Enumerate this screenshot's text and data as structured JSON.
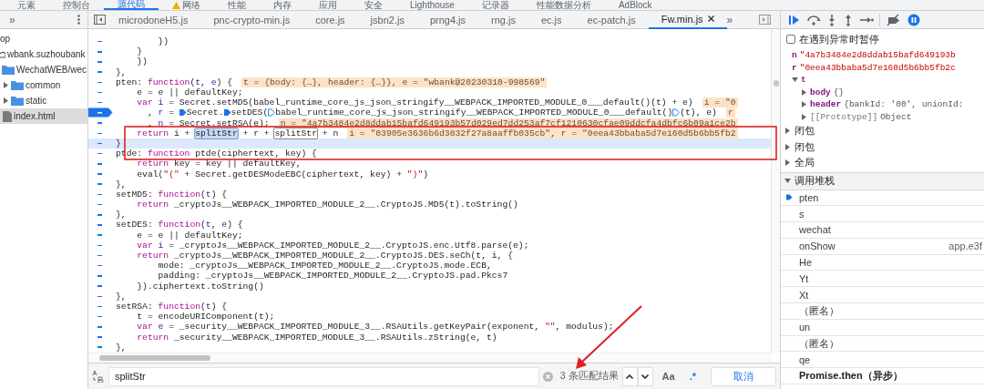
{
  "devtools_tabs": [
    {
      "label": "元素",
      "selected": false
    },
    {
      "label": "控制台",
      "selected": false
    },
    {
      "label": "源代码",
      "selected": true
    },
    {
      "label": "网络",
      "selected": false,
      "warning": true
    },
    {
      "label": "性能",
      "selected": false
    },
    {
      "label": "内存",
      "selected": false
    },
    {
      "label": "应用",
      "selected": false
    },
    {
      "label": "安全",
      "selected": false
    },
    {
      "label": "Lighthouse",
      "selected": false
    },
    {
      "label": "记录器",
      "selected": false
    },
    {
      "label": "性能数据分析",
      "selected": false
    },
    {
      "label": "AdBlock",
      "selected": false
    }
  ],
  "navigator": {
    "more": "»",
    "tree": [
      {
        "label": "op",
        "selected": false,
        "children": [
          {
            "label": "wbank.suzhoubank",
            "kind": "domain",
            "selected": false,
            "children": [
              {
                "label": "WechatWEB/wec",
                "kind": "folder",
                "selected": false,
                "children": [
                  {
                    "label": "common",
                    "kind": "folder",
                    "expanded": false,
                    "selected": false
                  },
                  {
                    "label": "static",
                    "kind": "folder",
                    "expanded": false,
                    "selected": false
                  },
                  {
                    "label": "index.html",
                    "kind": "file",
                    "selected": true
                  }
                ]
              }
            ]
          }
        ]
      }
    ]
  },
  "file_tabs": [
    {
      "label": "microdoneH5.js",
      "selected": false
    },
    {
      "label": "pnc-crypto-min.js",
      "selected": false
    },
    {
      "label": "core.js",
      "selected": false
    },
    {
      "label": "jsbn2.js",
      "selected": false
    },
    {
      "label": "prng4.js",
      "selected": false
    },
    {
      "label": "rng.js",
      "selected": false
    },
    {
      "label": "ec.js",
      "selected": false
    },
    {
      "label": "ec-patch.js",
      "selected": false
    },
    {
      "label": "Fw.min.js",
      "selected": true
    }
  ],
  "more_tabs": "»",
  "lines": [
    {
      "bp": false,
      "current": false,
      "parts": [
        "        })"
      ]
    },
    {
      "bp": false,
      "current": false,
      "parts": [
        "    }"
      ]
    },
    {
      "bp": false,
      "current": false,
      "parts": [
        "    })"
      ]
    },
    {
      "bp": false,
      "current": false,
      "parts": [
        "},"
      ]
    },
    {
      "bp": false,
      "current": false,
      "parts": [
        "pten: ",
        {
          "kind": "kw",
          "t": "function"
        },
        "(",
        {
          "kind": "param",
          "t": "t"
        },
        ", ",
        {
          "kind": "param",
          "t": "e"
        },
        ") {"
      ],
      "inline": "t = {body: {…}, header: {…}}, e = \"wbank@20230310-998569\""
    },
    {
      "bp": false,
      "current": false,
      "parts": [
        "    e = e || defaultKey;"
      ]
    },
    {
      "bp": false,
      "current": false,
      "parts": [
        {
          "kind": "kw",
          "t": "    var"
        },
        {
          "kind": "param",
          "t": " i"
        },
        " = Secret.setMD5(babel_runtime_core_js_json_stringify__WEBPACK_IMPORTED_MODULE_0___default()(t) + e)"
      ],
      "inline": "i = \"0"
    },
    {
      "bp": true,
      "current": false,
      "parts": [
        "      , ",
        {
          "kind": "param",
          "t": "r"
        },
        " = ",
        {
          "kind": "bp"
        },
        "Secret.",
        {
          "kind": "bp"
        },
        "setDES(",
        {
          "kind": "bp_off"
        },
        "babel_runtime_core_js_json_stringify__WEBPACK_IMPORTED_MODULE_0___default()",
        {
          "kind": "bp_off"
        },
        "(t), e)"
      ],
      "inline": "r"
    },
    {
      "bp": false,
      "current": false,
      "parts": [
        "      , ",
        {
          "kind": "param",
          "t": "n"
        },
        " = Secret.setRSA(e);"
      ],
      "inline": "n = \"4a7b3484e2d8ddab15bafd649193b57d029ed7dd253af7cf1210630cfae09ddcfa4dbfc6b09a1ce2b"
    },
    {
      "bp": false,
      "current": false,
      "parts": [
        {
          "kind": "kw",
          "t": "    return"
        },
        " i + ",
        {
          "kind": "match_current",
          "t": "splitStr"
        },
        " + r + ",
        {
          "kind": "match",
          "t": "splitStr"
        },
        " + n"
      ],
      "inline": "i = \"03905e3636b6d3832f27a8aaffb035cb\", r = \"0eea43bbaba5d7e160d5b6bb5fb2"
    },
    {
      "bp": false,
      "current": true,
      "parts": [
        "}"
      ]
    },
    {
      "bp": false,
      "current": false,
      "parts": [
        "ptde: ",
        {
          "kind": "kw",
          "t": "function"
        },
        " ptde(ciphertext, key) {"
      ]
    },
    {
      "bp": false,
      "current": false,
      "parts": [
        {
          "kind": "kw",
          "t": "    return"
        },
        " key = key || defaultKey,"
      ]
    },
    {
      "bp": false,
      "current": false,
      "parts": [
        "    eval(",
        {
          "kind": "str",
          "t": "\"(\""
        },
        " + Secret.getDESModeEBC(ciphertext, key) + ",
        {
          "kind": "str",
          "t": "\")\""
        },
        ")"
      ]
    },
    {
      "bp": false,
      "current": false,
      "parts": [
        "},"
      ]
    },
    {
      "bp": false,
      "current": false,
      "parts": [
        "setMD5: ",
        {
          "kind": "kw",
          "t": "function"
        },
        "(",
        {
          "kind": "param",
          "t": "t"
        },
        ") {"
      ]
    },
    {
      "bp": false,
      "current": false,
      "parts": [
        {
          "kind": "kw",
          "t": "    return"
        },
        " _cryptoJs__WEBPACK_IMPORTED_MODULE_2__.CryptoJS.MD5(t).toString()"
      ]
    },
    {
      "bp": false,
      "current": false,
      "parts": [
        "},"
      ]
    },
    {
      "bp": false,
      "current": false,
      "parts": [
        "setDES: ",
        {
          "kind": "kw",
          "t": "function"
        },
        "(",
        {
          "kind": "param",
          "t": "t"
        },
        ", ",
        {
          "kind": "param",
          "t": "e"
        },
        ") {"
      ]
    },
    {
      "bp": false,
      "current": false,
      "parts": [
        "    e = e || defaultKey;"
      ]
    },
    {
      "bp": false,
      "current": false,
      "parts": [
        {
          "kind": "kw",
          "t": "    var"
        },
        {
          "kind": "param",
          "t": " i"
        },
        " = _cryptoJs__WEBPACK_IMPORTED_MODULE_2__.CryptoJS.enc.Utf8.parse(e);"
      ]
    },
    {
      "bp": false,
      "current": false,
      "parts": [
        {
          "kind": "kw",
          "t": "    return"
        },
        " _cryptoJs__WEBPACK_IMPORTED_MODULE_2__.CryptoJS.DES.seCh(t, i, {"
      ]
    },
    {
      "bp": false,
      "current": false,
      "parts": [
        "        mode: _cryptoJs__WEBPACK_IMPORTED_MODULE_2__.CryptoJS.mode.ECB,"
      ]
    },
    {
      "bp": false,
      "current": false,
      "parts": [
        "        padding: _cryptoJs__WEBPACK_IMPORTED_MODULE_2__.CryptoJS.pad.Pkcs7"
      ]
    },
    {
      "bp": false,
      "current": false,
      "parts": [
        "    }).ciphertext.toString()"
      ]
    },
    {
      "bp": false,
      "current": false,
      "parts": [
        "},"
      ]
    },
    {
      "bp": false,
      "current": false,
      "parts": [
        "setRSA: ",
        {
          "kind": "kw",
          "t": "function"
        },
        "(",
        {
          "kind": "param",
          "t": "t"
        },
        ") {"
      ]
    },
    {
      "bp": false,
      "current": false,
      "parts": [
        "    t = encodeURIComponent(t);"
      ]
    },
    {
      "bp": false,
      "current": false,
      "parts": [
        {
          "kind": "kw",
          "t": "    var"
        },
        {
          "kind": "param",
          "t": " e"
        },
        " = _security__WEBPACK_IMPORTED_MODULE_3__.RSAUtils.getKeyPair(exponent, ",
        {
          "kind": "str",
          "t": "\"\""
        },
        ", modulus);"
      ]
    },
    {
      "bp": false,
      "current": false,
      "parts": [
        {
          "kind": "kw",
          "t": "    return"
        },
        " _security__WEBPACK_IMPORTED_MODULE_3__.RSAUtils.zString(e, t)"
      ]
    },
    {
      "bp": false,
      "current": false,
      "parts": [
        "},"
      ]
    }
  ],
  "search": {
    "value": "splitStr",
    "count": "3 条匹配结果",
    "case_label": "Aa",
    "regex_label": ".*",
    "cancel": "取消"
  },
  "pause_on_exceptions": {
    "label": "在遇到异常时暂停",
    "checked": false
  },
  "scope": {
    "vars": [
      {
        "name": "n",
        "kind": "string",
        "value": "\"4a7b3484e2d8ddab15bafd649193b"
      },
      {
        "name": "r",
        "kind": "string",
        "value": "\"0eea43bbaba5d7e160d5b6bb5fb2c"
      },
      {
        "name": "t",
        "kind": "object",
        "expanded": true,
        "children": [
          {
            "name": "body",
            "kind": "object",
            "value": "{}",
            "expanded": false
          },
          {
            "name": "header",
            "kind": "object",
            "value": "{bankId: '00', unionId:",
            "expanded": false
          },
          {
            "name": "[[Prototype]]",
            "kind": "internal",
            "value": "Object",
            "expanded": false
          }
        ]
      }
    ],
    "groups": [
      {
        "label": "闭包",
        "expanded": false
      },
      {
        "label": "闭包",
        "expanded": false
      },
      {
        "label": "全局",
        "expanded": false
      }
    ]
  },
  "call_stack": {
    "title": "调用堆栈",
    "expanded": true,
    "frames": [
      {
        "name": "pten",
        "kind": "frame",
        "selected": true
      },
      {
        "name": "s",
        "kind": "frame",
        "selected": false
      },
      {
        "name": "wechat",
        "kind": "frame",
        "selected": false
      },
      {
        "name": "onShow",
        "location": "app.e3f",
        "kind": "frame",
        "selected": false
      },
      {
        "name": "He",
        "kind": "frame",
        "selected": false
      },
      {
        "name": "Yt",
        "kind": "frame",
        "selected": false
      },
      {
        "name": "Xt",
        "kind": "frame",
        "selected": false
      },
      {
        "name": "（匿名）",
        "kind": "frame",
        "selected": false
      },
      {
        "name": "un",
        "kind": "frame",
        "selected": false
      },
      {
        "name": "（匿名）",
        "kind": "frame",
        "selected": false
      },
      {
        "name": "qe",
        "kind": "frame",
        "selected": false
      },
      {
        "name": "Promise.then（异步）",
        "kind": "async",
        "selected": false
      }
    ]
  }
}
